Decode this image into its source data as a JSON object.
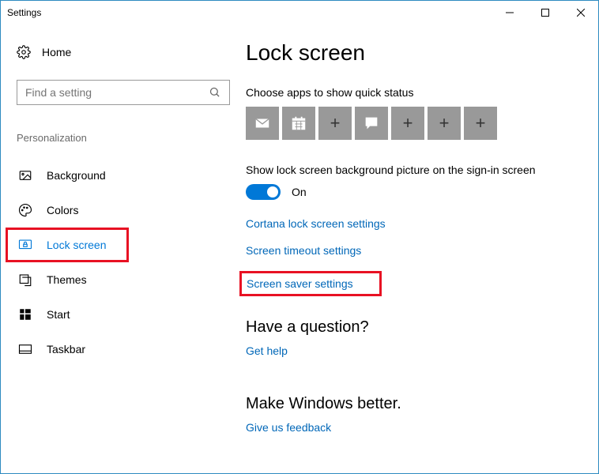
{
  "window": {
    "title": "Settings"
  },
  "sidebar": {
    "home_label": "Home",
    "search_placeholder": "Find a setting",
    "category": "Personalization",
    "items": [
      {
        "label": "Background"
      },
      {
        "label": "Colors"
      },
      {
        "label": "Lock screen"
      },
      {
        "label": "Themes"
      },
      {
        "label": "Start"
      },
      {
        "label": "Taskbar"
      }
    ],
    "active_index": 2
  },
  "content": {
    "title": "Lock screen",
    "quick_status_label": "Choose apps to show quick status",
    "signin_bg_label": "Show lock screen background picture on the sign-in screen",
    "toggle_state": "On",
    "links": {
      "cortana": "Cortana lock screen settings",
      "timeout": "Screen timeout settings",
      "screensaver": "Screen saver settings"
    },
    "question_heading": "Have a question?",
    "question_link": "Get help",
    "feedback_heading": "Make Windows better.",
    "feedback_link": "Give us feedback"
  }
}
